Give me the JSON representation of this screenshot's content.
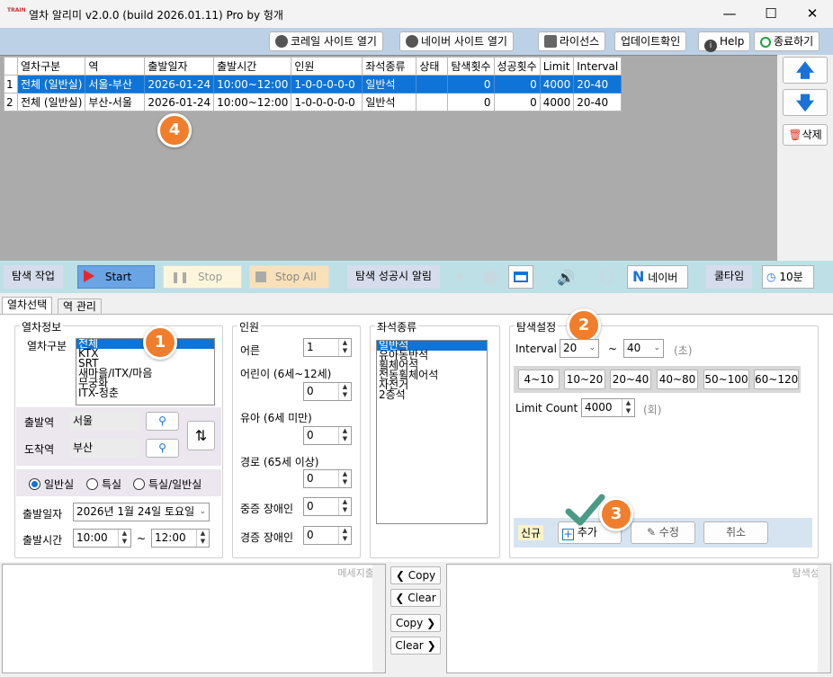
{
  "window": {
    "title": "열차 알리미 v2.0.0 (build 2026.01.11) Pro by 헝개",
    "logo_text": "TRAIN"
  },
  "toolbar": {
    "korail": "코레일 사이트 열기",
    "naver": "네이버 사이트 열기",
    "license": "라이선스",
    "update": "업데이트확인",
    "help": "Help",
    "exit": "종료하기"
  },
  "grid": {
    "columns": [
      "열차구분",
      "역",
      "출발일자",
      "출발시간",
      "인원",
      "좌석종류",
      "상태",
      "탐색횟수",
      "성공횟수",
      "Limit",
      "Interval"
    ],
    "rows": [
      {
        "no": "1",
        "cells": [
          "전체 (일반실)",
          "서울-부산",
          "2026-01-24",
          "10:00~12:00",
          "1-0-0-0-0-0",
          "일반석",
          "",
          "0",
          "0",
          "4000",
          "20-40"
        ]
      },
      {
        "no": "2",
        "cells": [
          "전체 (일반실)",
          "부산-서울",
          "2026-01-24",
          "10:00~12:00",
          "1-0-0-0-0-0",
          "일반석",
          "",
          "0",
          "0",
          "4000",
          "20-40"
        ]
      }
    ]
  },
  "side": {
    "up_icon": "arrow-up-icon",
    "down_icon": "arrow-down-icon",
    "delete": "삭제"
  },
  "controls": {
    "search_task": "탐색 작업",
    "start": "Start",
    "stop": "Stop",
    "stop_all": "Stop All",
    "alert_label": "탐색 성공시 알림",
    "naver": "네이버",
    "cooltime": "쿨타임",
    "cooltime_value": "10분"
  },
  "tabs": [
    "열차선택",
    "역 관리"
  ],
  "train_info": {
    "title": "열차정보",
    "type_label": "열차구분",
    "types": [
      "전체",
      "KTX",
      "SRT",
      "새마을/ITX/마음",
      "무궁화",
      "ITX-청춘"
    ],
    "selected_type": 0,
    "dep_label": "출발역",
    "dep_value": "서울",
    "arr_label": "도착역",
    "arr_value": "부산",
    "seat_classes": [
      "일반실",
      "특실",
      "특실/일반실"
    ],
    "selected_class": 0,
    "date_label": "출발일자",
    "date_value": "2026년   1월 24일 토요일",
    "time_label": "출발시간",
    "time_from": "10:00",
    "time_to": "12:00",
    "tilde": "~"
  },
  "persons": {
    "title": "인원",
    "items": [
      {
        "label": "어른",
        "value": "1"
      },
      {
        "label": "어린이 (6세~12세)",
        "value": "0"
      },
      {
        "label": "유아 (6세 미만)",
        "value": "0"
      },
      {
        "label": "경로 (65세 이상)",
        "value": "0"
      },
      {
        "label": "중증 장애인",
        "value": "0"
      },
      {
        "label": "경증 장애인",
        "value": "0"
      }
    ]
  },
  "seats": {
    "title": "좌석종류",
    "items": [
      "일반석",
      "유아동반석",
      "휠체어석",
      "전동휠체어석",
      "자전거",
      "2층석"
    ],
    "selected": 0
  },
  "search_settings": {
    "title": "탐색설정",
    "interval_label": "Interval",
    "interval_from": "20",
    "interval_to": "40",
    "tilde": "~",
    "interval_unit": "(초)",
    "ranges": [
      "4~10",
      "10~20",
      "20~40",
      "40~80",
      "50~100",
      "60~120"
    ],
    "limit_label": "Limit Count",
    "limit_value": "4000",
    "limit_unit": "(회)",
    "new_label": "신규",
    "add": "추가",
    "edit": "수정",
    "cancel": "취소"
  },
  "badges": [
    "1",
    "2",
    "3",
    "4"
  ],
  "bottom": {
    "message_label": "메세지출력",
    "success_label": "탐색성공",
    "copy_left": "Copy",
    "clear_left": "Clear",
    "copy_right": "Copy",
    "clear_right": "Clear"
  },
  "colors": {
    "selection": "#0e74d8",
    "badge": "#f07e2c",
    "check": "#4a9a86"
  }
}
